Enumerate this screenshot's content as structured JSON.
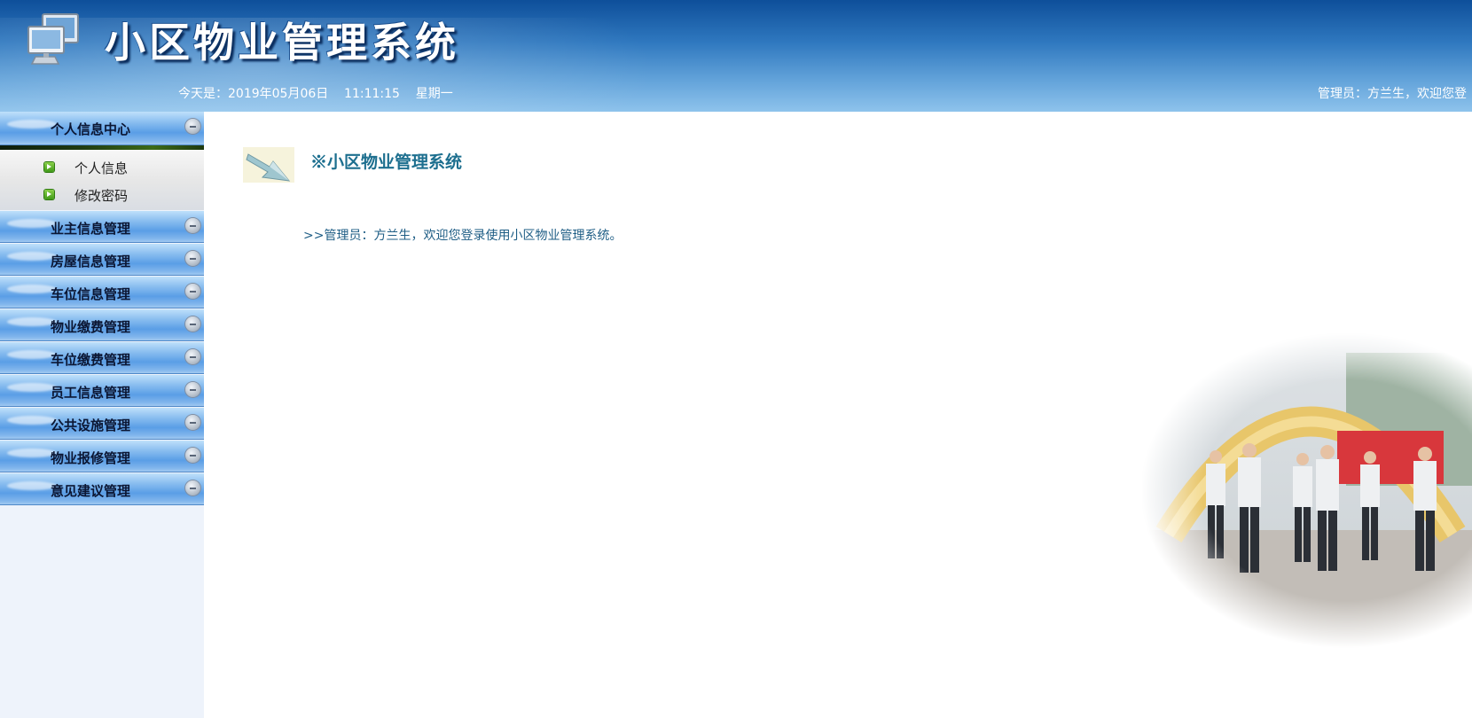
{
  "header": {
    "title": "小区物业管理系统",
    "date_line": "今天是：2019年05月06日    11:11:15    星期一",
    "admin_line": "管理员：方兰生，欢迎您登"
  },
  "sidebar": {
    "personal_center": {
      "label": "个人信息中心",
      "items": [
        {
          "label": "个人信息"
        },
        {
          "label": "修改密码"
        }
      ]
    },
    "menus": [
      {
        "label": "业主信息管理"
      },
      {
        "label": "房屋信息管理"
      },
      {
        "label": "车位信息管理"
      },
      {
        "label": "物业缴费管理"
      },
      {
        "label": "车位缴费管理"
      },
      {
        "label": "员工信息管理"
      },
      {
        "label": "公共设施管理"
      },
      {
        "label": "物业报修管理"
      },
      {
        "label": "意见建议管理"
      }
    ]
  },
  "main": {
    "welcome_title": "※小区物业管理系统",
    "welcome_message": ">>管理员：方兰生，欢迎您登录使用小区物业管理系统。"
  },
  "icons": {
    "logo": "computer-monitors-icon",
    "collapse": "collapse-minus-icon",
    "sub_item": "green-arrow-icon",
    "welcome": "arrow-icon"
  },
  "colors": {
    "header_dark": "#0e4f9a",
    "header_light": "#8ec3ec",
    "menu_blue": "#5a9ee6",
    "sidebar_bg": "#eef3fb",
    "welcome_text": "#1e5d85",
    "title_teal": "#1d6f8f"
  }
}
